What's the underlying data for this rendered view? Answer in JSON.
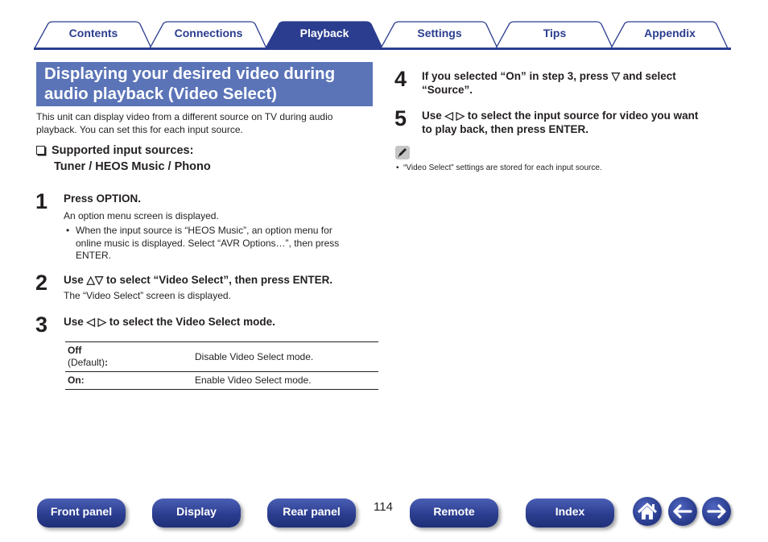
{
  "tabs": [
    {
      "label": "Contents",
      "active": false
    },
    {
      "label": "Connections",
      "active": false
    },
    {
      "label": "Playback",
      "active": true
    },
    {
      "label": "Settings",
      "active": false
    },
    {
      "label": "Tips",
      "active": false
    },
    {
      "label": "Appendix",
      "active": false
    }
  ],
  "colors": {
    "accent": "#2b3d8f",
    "title_bg": "#5b74b8"
  },
  "title": {
    "line1": "Displaying your desired video during",
    "line2": "audio playback (Video Select)"
  },
  "intro": {
    "line1": "This unit can display video from a different source on TV during audio",
    "line2": "playback. You can set this for each input source."
  },
  "supported": {
    "label": "Supported input sources:",
    "sources": "Tuner / HEOS Music / Phono"
  },
  "steps": [
    {
      "num": "1",
      "text": "Press OPTION.",
      "sub": "An option menu screen is displayed.",
      "bullet": {
        "line1": "When the input source is “HEOS Music”, an option menu for",
        "line2": "online music is displayed. Select “AVR Options…”, then press",
        "line3": "ENTER."
      }
    },
    {
      "num": "2",
      "text": "Use △▽ to select “Video Select”, then press ENTER.",
      "sub": "The “Video Select” screen is displayed."
    },
    {
      "num": "3",
      "text": "Use ◁ ▷ to select the Video Select mode."
    },
    {
      "num": "4",
      "line1": "If you selected “On” in step 3, press ▽ and select",
      "line2": "“Source”."
    },
    {
      "num": "5",
      "line1": "Use ◁ ▷ to select the input source for video you want",
      "line2": "to play back, then press ENTER."
    }
  ],
  "modes": [
    {
      "key": "Off",
      "key_note": "(Default)",
      "desc": "Disable Video Select mode."
    },
    {
      "key": "On:",
      "desc": "Enable Video Select mode."
    }
  ],
  "note": {
    "icon": "pencil-icon",
    "bullet": "•",
    "text": "“Video Select” settings are stored for each input source."
  },
  "bottom_nav": {
    "buttons": [
      "Front panel",
      "Display",
      "Rear panel",
      "Remote",
      "Index"
    ],
    "page_number": "114",
    "icons": [
      "home-icon",
      "back-arrow-icon",
      "forward-arrow-icon"
    ]
  }
}
